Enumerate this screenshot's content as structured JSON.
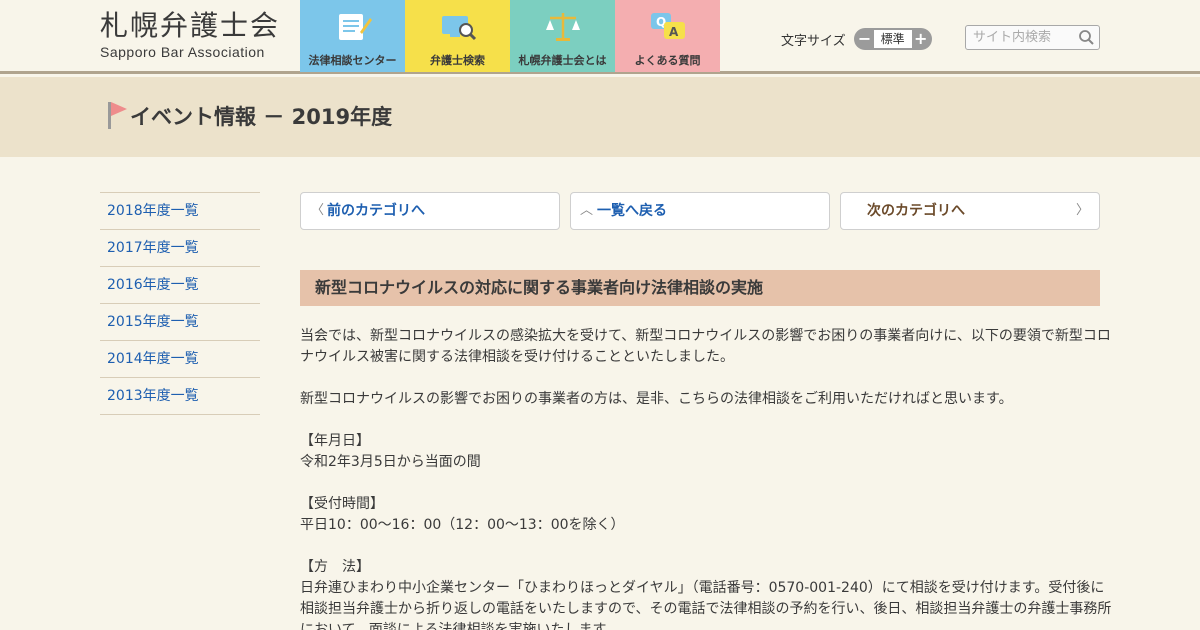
{
  "logo": {
    "jp": "札幌弁護士会",
    "en": "Sapporo Bar Association"
  },
  "nav": [
    {
      "label": "法律相談センター",
      "icon": "memo-icon",
      "color": "#7cc6ea"
    },
    {
      "label": "弁護士検索",
      "icon": "search-screen-icon",
      "color": "#f6e04a"
    },
    {
      "label": "札幌弁護士会とは",
      "icon": "scales-icon",
      "color": "#7ccfc0"
    },
    {
      "label": "よくある質問",
      "icon": "qa-bubbles-icon",
      "color": "#f4aeb0"
    }
  ],
  "font_size": {
    "label": "文字サイズ",
    "minus": "−",
    "value": "標準",
    "plus": "+"
  },
  "search": {
    "placeholder": "サイト内検索"
  },
  "page_title": "イベント情報 － 2019年度",
  "sidebar": {
    "items": [
      {
        "label": "2018年度一覧"
      },
      {
        "label": "2017年度一覧"
      },
      {
        "label": "2016年度一覧"
      },
      {
        "label": "2015年度一覧"
      },
      {
        "label": "2014年度一覧"
      },
      {
        "label": "2013年度一覧"
      }
    ]
  },
  "category_nav": {
    "prev": {
      "arrow": "〈",
      "label": "前のカテゴリへ"
    },
    "list": {
      "arrow": "︿",
      "label": "一覧へ戻る"
    },
    "next": {
      "arrow": "〉",
      "label": "次のカテゴリへ"
    }
  },
  "article": {
    "heading": "新型コロナウイルスの対応に関する事業者向け法律相談の実施",
    "para1": "当会では、新型コロナウイルスの感染拡大を受けて、新型コロナウイルスの影響でお困りの事業者向けに、以下の要領で新型コロナウイルス被害に関する法律相談を受け付けることといたしました。",
    "para2": "新型コロナウイルスの影響でお困りの事業者の方は、是非、こちらの法律相談をご利用いただければと思います。",
    "date_label": "【年月日】",
    "date_value": "令和2年3月5日から当面の間",
    "hours_label": "【受付時間】",
    "hours_value": "平日10：00～16：00（12：00～13：00を除く）",
    "method_label": "【方　法】",
    "method_value": "日弁連ひまわり中小企業センター「ひまわりほっとダイヤル」（電話番号：0570-001-240）にて相談を受け付けます。受付後に相談担当弁護士から折り返しの電話をいたしますので、その電話で法律相談の予約を行い、後日、相談担当弁護士の弁護士事務所において、面談による法律相談を実施いたします。"
  }
}
